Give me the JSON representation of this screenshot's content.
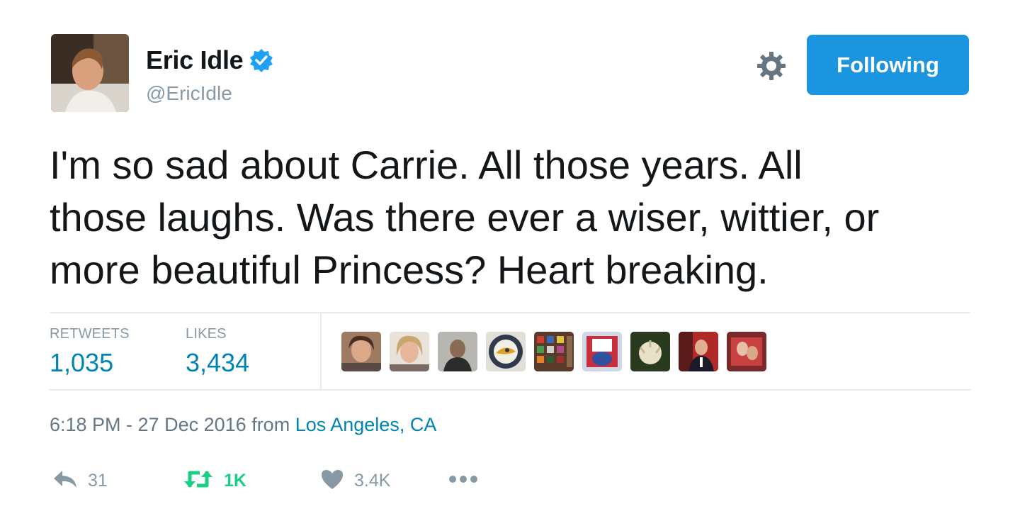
{
  "author": {
    "display_name": "Eric Idle",
    "handle": "@EricIdle",
    "verified": true
  },
  "header": {
    "follow_button_label": "Following",
    "settings_icon": "gear-icon"
  },
  "tweet": {
    "text": "I'm so sad about Carrie.  All those years.  All\nthose laughs.  Was there ever a wiser, wittier, or\nmore beautiful Princess?  Heart breaking."
  },
  "stats": {
    "retweets_label": "RETWEETS",
    "retweets_value": "1,035",
    "likes_label": "LIKES",
    "likes_value": "3,434"
  },
  "likers_count_shown": 9,
  "meta": {
    "timestamp": "6:18 PM - 27 Dec 2016",
    "from_word": "from",
    "location": "Los Angeles, CA"
  },
  "actions": {
    "reply_count": "31",
    "retweet_count": "1K",
    "like_count": "3.4K"
  },
  "colors": {
    "accent": "#1b95e0",
    "link": "#0084b4",
    "retweet_active": "#19cf86",
    "muted": "#8899a6",
    "text": "#14171a"
  }
}
